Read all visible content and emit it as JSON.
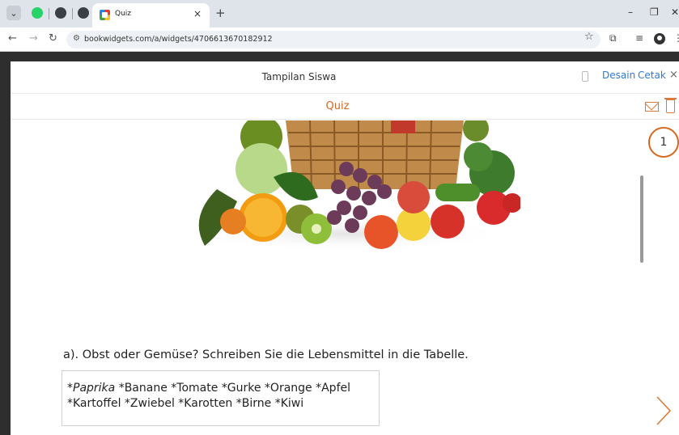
{
  "browser": {
    "tab_title": "Quiz",
    "tab_close": "×",
    "new_tab": "+",
    "url": "bookwidgets.com/a/widgets/4706613670182912",
    "icons": [
      "chevron-down-icon",
      "whatsapp-icon",
      "extension-icon",
      "extension-icon",
      "quiz-favicon",
      "close-icon",
      "plus-icon",
      "minimize-icon",
      "restore-icon",
      "close-icon",
      "back-icon",
      "forward-icon",
      "reload-icon",
      "site-settings-icon",
      "star-icon",
      "extensions-icon",
      "reading-list-icon",
      "profile-icon",
      "menu-icon"
    ]
  },
  "modal": {
    "title": "Tampilan Siswa",
    "design_link": "Desain",
    "print_link": "Cetak",
    "close": "×"
  },
  "quiz": {
    "title": "Quiz",
    "step": "1",
    "question": "a). Obst oder Gemüse? Schreiben Sie die Lebensmittel in die Tabelle.",
    "words_italic": "*Paprika",
    "words_line1": " *Banane *Tomate *Gurke *Orange *Apfel",
    "words_line2": "*Kartoffel *Zwiebel *Karotten *Birne *Kiwi"
  },
  "colors": {
    "accent_orange": "#d2691e",
    "link_blue": "#2f7bd1"
  }
}
